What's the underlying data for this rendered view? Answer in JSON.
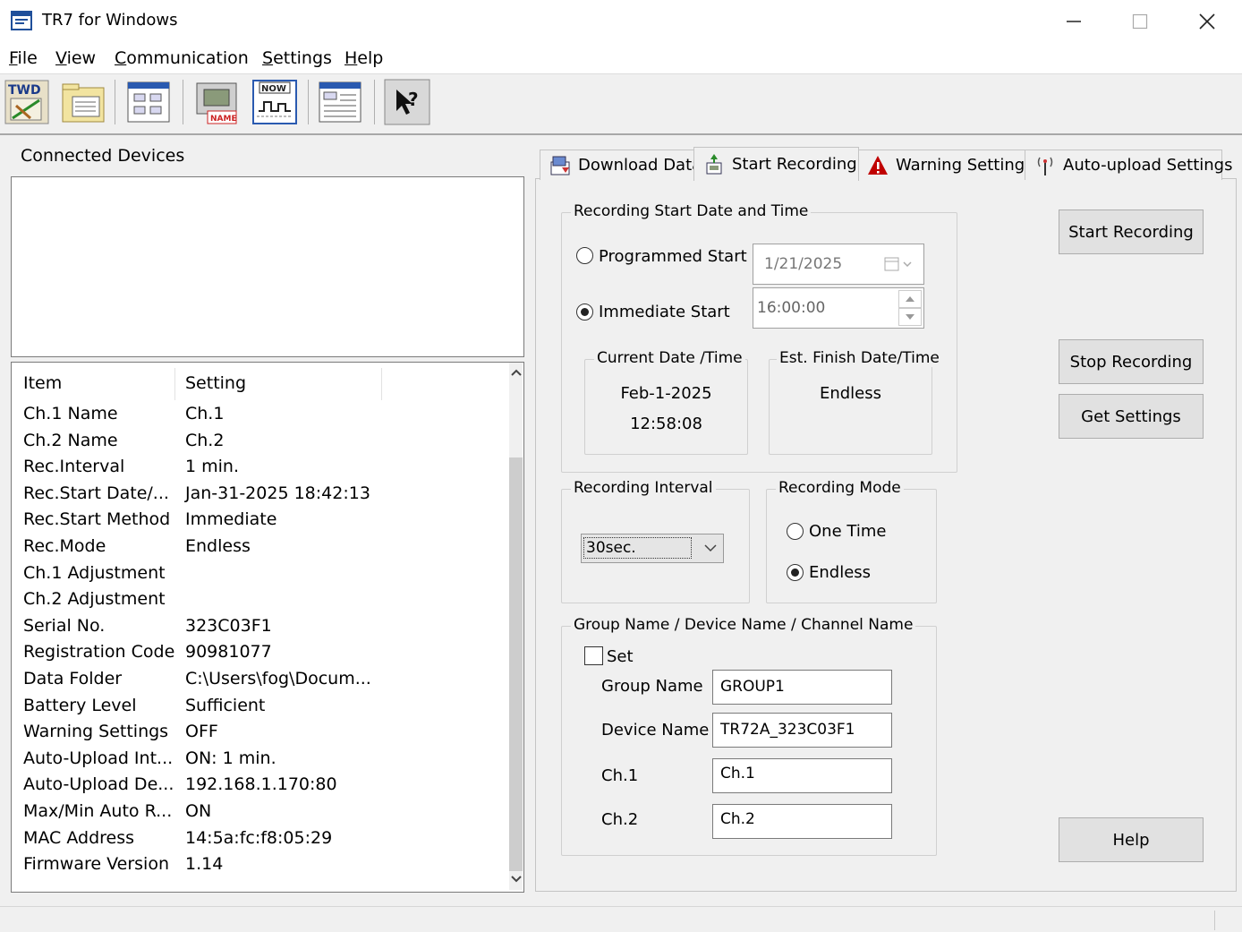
{
  "window": {
    "title": "TR7 for Windows"
  },
  "menu": [
    {
      "key": "F",
      "rest": "ile"
    },
    {
      "key": "V",
      "rest": "iew"
    },
    {
      "key": "C",
      "rest": "ommunication"
    },
    {
      "key": "S",
      "rest": "ettings"
    },
    {
      "key": "H",
      "rest": "elp"
    }
  ],
  "toolbar": {
    "buttons": [
      "download-icon",
      "folder-view-icon",
      "window-layout-icon",
      "device-name-icon",
      "now-monitor-icon",
      "list-view-icon",
      "context-help-icon"
    ],
    "name_badge": "NAME",
    "now_badge": "NOW"
  },
  "left": {
    "connected_label": "Connected Devices",
    "columns": {
      "item": "Item",
      "setting": "Setting"
    },
    "rows": [
      [
        "Ch.1 Name",
        "Ch.1"
      ],
      [
        "Ch.2 Name",
        "Ch.2"
      ],
      [
        "Rec.Interval",
        "1 min."
      ],
      [
        "Rec.Start Date/...",
        "Jan-31-2025 18:42:13"
      ],
      [
        "Rec.Start Method",
        "Immediate"
      ],
      [
        "Rec.Mode",
        "Endless"
      ],
      [
        "Ch.1 Adjustment",
        ""
      ],
      [
        "Ch.2 Adjustment",
        ""
      ],
      [
        "Serial No.",
        "323C03F1"
      ],
      [
        "Registration Code",
        "90981077"
      ],
      [
        "Data Folder",
        "C:\\Users\\fog\\Docum..."
      ],
      [
        "Battery Level",
        "Sufficient"
      ],
      [
        "Warning Settings",
        "OFF"
      ],
      [
        "Auto-Upload Int...",
        "ON: 1 min."
      ],
      [
        "Auto-Upload De...",
        "192.168.1.170:80"
      ],
      [
        "Max/Min Auto R...",
        "ON"
      ],
      [
        "MAC Address",
        "14:5a:fc:f8:05:29"
      ],
      [
        "Firmware Version",
        "1.14"
      ]
    ]
  },
  "tabs": [
    {
      "label": "Download Data",
      "icon": "download-data-icon"
    },
    {
      "label": "Start Recording",
      "icon": "start-recording-icon",
      "active": true
    },
    {
      "label": "Warning Settings",
      "icon": "warning-icon"
    },
    {
      "label": "Auto-upload Settings",
      "icon": "antenna-icon"
    }
  ],
  "start_recording": {
    "start_group": {
      "title": "Recording Start Date and Time",
      "programmed": "Programmed Start",
      "immediate": "Immediate Start",
      "selected": "immediate",
      "date_value": "1/21/2025",
      "time_value": "16:00:00",
      "current_title": "Current Date /Time",
      "current_date": "Feb-1-2025",
      "current_time": "12:58:08",
      "finish_title": "Est. Finish Date/Time",
      "finish_value": "Endless"
    },
    "interval_group": {
      "title": "Recording Interval",
      "value": "30sec."
    },
    "mode_group": {
      "title": "Recording Mode",
      "one_time": "One Time",
      "endless": "Endless",
      "selected": "endless"
    },
    "names_group": {
      "title": "Group Name / Device Name / Channel Name",
      "set_label": "Set",
      "set_checked": false,
      "group_label": "Group Name",
      "group_value": "GROUP1",
      "device_label": "Device Name",
      "device_value": "TR72A_323C03F1",
      "ch1_label": "Ch.1",
      "ch1_value": "Ch.1",
      "ch2_label": "Ch.2",
      "ch2_value": "Ch.2"
    },
    "buttons": {
      "start": "Start Recording",
      "stop": "Stop Recording",
      "get": "Get Settings",
      "help": "Help"
    }
  }
}
